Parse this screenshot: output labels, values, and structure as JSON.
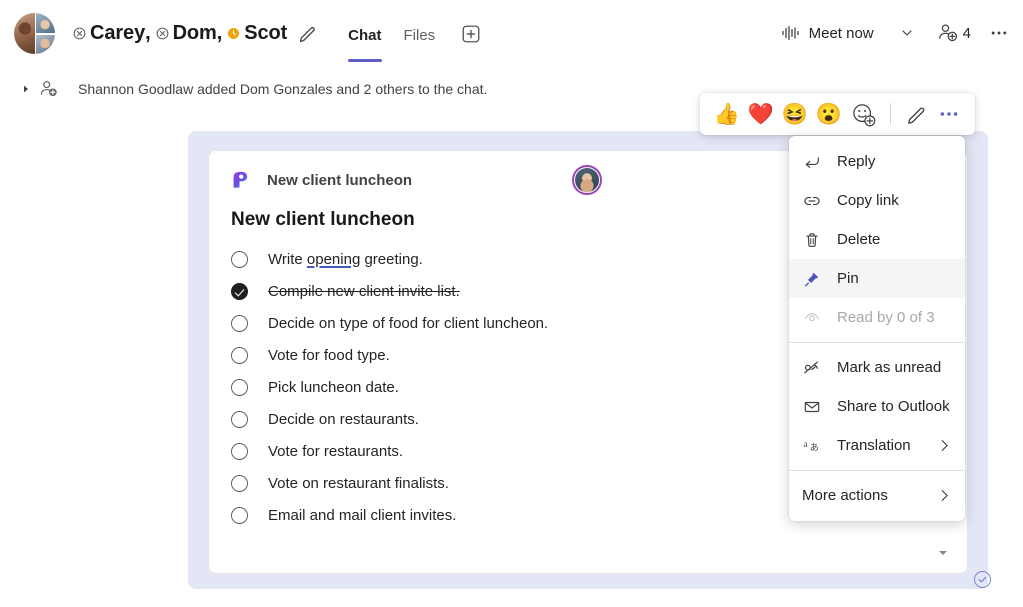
{
  "header": {
    "avatar_name": "group-avatar",
    "participants": [
      {
        "name": "Carey",
        "presence": "offline",
        "comma": ","
      },
      {
        "name": "Dom",
        "presence": "offline",
        "comma": ","
      },
      {
        "name": "Scot",
        "presence": "away",
        "comma": ""
      }
    ],
    "edit_title_icon": "pencil-icon",
    "tabs": [
      {
        "label": "Chat",
        "active": true
      },
      {
        "label": "Files",
        "active": false
      }
    ],
    "add_tab_icon": "plus-box-icon",
    "meet_now": {
      "label": "Meet now",
      "icon": "audio-waveform-icon",
      "chevron": "chevron-down-icon"
    },
    "people": {
      "icon": "add-people-icon",
      "count": "4"
    },
    "more_icon": "more-horizontal-icon"
  },
  "system_message": {
    "caret": "expand-caret-icon",
    "icon": "person-added-icon",
    "text": "Shannon Goodlaw added Dom Gonzales and 2 others to the chat."
  },
  "message": {
    "card": {
      "app_icon": "planner-app-icon",
      "app_name": "New client luncheon",
      "avatar": "sender-avatar",
      "title": "New client luncheon",
      "tasks": [
        {
          "text": "Write opening greeting.",
          "checked": false,
          "spellcheck_word": "opening",
          "prefix": "Write ",
          "suffix": " greeting."
        },
        {
          "text": "Compile new client invite list.",
          "checked": true
        },
        {
          "text": "Decide on type of food for client luncheon.",
          "checked": false
        },
        {
          "text": "Vote for food type.",
          "checked": false
        },
        {
          "text": "Pick luncheon date.",
          "checked": false
        },
        {
          "text": "Decide on restaurants.",
          "checked": false
        },
        {
          "text": "Vote for restaurants.",
          "checked": false
        },
        {
          "text": "Vote on restaurant finalists.",
          "checked": false
        },
        {
          "text": "Email and mail client invites.",
          "checked": false
        }
      ],
      "scroll_arrow": "scroll-down-arrow-icon"
    },
    "sent_status_icon": "sent-check-icon"
  },
  "reaction_toolbar": {
    "reactions": [
      {
        "name": "thumbs-up-reaction",
        "glyph": "👍"
      },
      {
        "name": "heart-reaction",
        "glyph": "❤️"
      },
      {
        "name": "laugh-reaction",
        "glyph": "😆"
      },
      {
        "name": "surprised-reaction",
        "glyph": "😮"
      },
      {
        "name": "add-reaction",
        "glyph": "🙂"
      }
    ],
    "edit_icon": "pencil-icon",
    "more_icon": "more-horizontal-icon"
  },
  "context_menu": {
    "items": [
      {
        "label": "Reply",
        "icon": "reply-arrow-icon",
        "selected": false,
        "disabled": false,
        "submenu": false
      },
      {
        "label": "Copy link",
        "icon": "link-icon",
        "selected": false,
        "disabled": false,
        "submenu": false
      },
      {
        "label": "Delete",
        "icon": "trash-icon",
        "selected": false,
        "disabled": false,
        "submenu": false
      },
      {
        "label": "Pin",
        "icon": "pin-icon",
        "selected": true,
        "disabled": false,
        "submenu": false
      },
      {
        "label": "Read by 0 of 3",
        "icon": "eye-icon",
        "selected": false,
        "disabled": true,
        "submenu": false
      },
      {
        "label": "Mark as unread",
        "icon": "mark-unread-icon",
        "selected": false,
        "disabled": false,
        "submenu": false
      },
      {
        "label": "Share to Outlook",
        "icon": "envelope-icon",
        "selected": false,
        "disabled": false,
        "submenu": false
      },
      {
        "label": "Translation",
        "icon": "translate-icon",
        "selected": false,
        "disabled": false,
        "submenu": true
      },
      {
        "label": "More actions",
        "icon": "",
        "selected": false,
        "disabled": false,
        "submenu": true
      }
    ],
    "submenu_chevron": "chevron-right-icon"
  },
  "colors": {
    "accent": "#5b5fc7",
    "bubble_bg": "#e3e6f5",
    "away": "#f0a30a",
    "pin": "#4b53bc",
    "avatar_ring": "#9a44b7"
  }
}
